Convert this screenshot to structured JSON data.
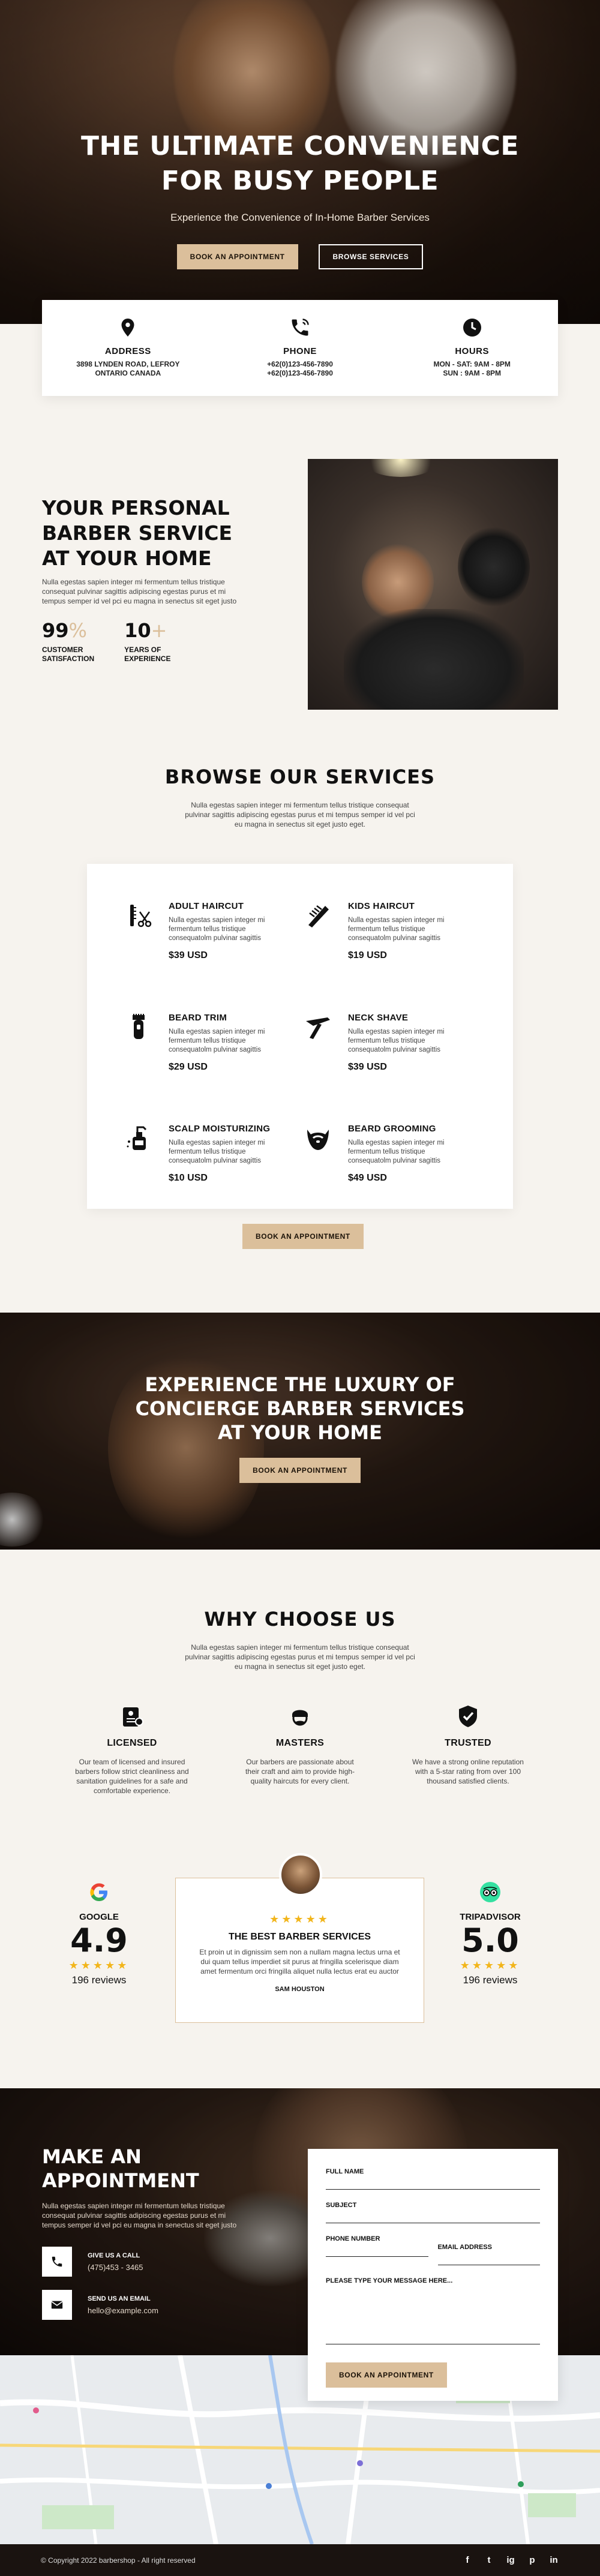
{
  "hero": {
    "title_line1": "THE ULTIMATE CONVENIENCE",
    "title_line2": "FOR BUSY PEOPLE",
    "subtitle": "Experience the Convenience of In-Home Barber Services",
    "btn_appointment": "BOOK AN APPOINTMENT",
    "btn_services": "BROWSE SERVICES"
  },
  "contact": [
    {
      "icon": "location-pin-icon",
      "title": "ADDRESS",
      "line1": "3898 LYNDEN ROAD, LEFROY",
      "line2": "ONTARIO CANADA"
    },
    {
      "icon": "phone-icon",
      "title": "PHONE",
      "line1": "+62(0)123-456-7890",
      "line2": "+62(0)123-456-7890"
    },
    {
      "icon": "clock-icon",
      "title": "HOURS",
      "line1": "MON - SAT: 9AM - 8PM",
      "line2": "SUN : 9AM - 8PM"
    }
  ],
  "about": {
    "title_line1": "YOUR PERSONAL",
    "title_line2": "BARBER SERVICE",
    "title_line3": "AT YOUR HOME",
    "text": "Nulla egestas sapien integer mi fermentum tellus tristique consequat pulvinar sagittis adipiscing egestas purus et mi tempus semper id vel pci eu magna in senectus sit eget justo",
    "stat1_num": "99",
    "stat1_suffix": "%",
    "stat1_label1": "CUSTOMER",
    "stat1_label2": "SATISFACTION",
    "stat2_num": "10",
    "stat2_suffix": "+",
    "stat2_label1": "YEARS OF",
    "stat2_label2": "EXPERIENCE"
  },
  "services": {
    "title": "BROWSE OUR SERVICES",
    "text": "Nulla egestas sapien integer mi fermentum tellus tristique consequat pulvinar sagittis adipiscing egestas purus et mi tempus semper id vel pci eu magna in senectus sit eget justo eget.",
    "items": [
      {
        "icon": "razor-comb-icon",
        "name": "ADULT HAIRCUT",
        "desc": "Nulla egestas sapien integer mi fermentum tellus tristique consequatolm pulvinar sagittis",
        "price": "$39 USD"
      },
      {
        "icon": "comb-icon",
        "name": "KIDS HAIRCUT",
        "desc": "Nulla egestas sapien integer mi fermentum tellus tristique consequatolm pulvinar sagittis",
        "price": "$19 USD"
      },
      {
        "icon": "trimmer-icon",
        "name": "BEARD TRIM",
        "desc": "Nulla egestas sapien integer mi fermentum tellus tristique consequatolm pulvinar sagittis",
        "price": "$29 USD"
      },
      {
        "icon": "straight-razor-icon",
        "name": "NECK SHAVE",
        "desc": "Nulla egestas sapien integer mi fermentum tellus tristique consequatolm pulvinar sagittis",
        "price": "$39 USD"
      },
      {
        "icon": "lotion-bottle-icon",
        "name": "SCALP MOISTURIZING",
        "desc": "Nulla egestas sapien integer mi fermentum tellus tristique consequatolm pulvinar sagittis",
        "price": "$10 USD"
      },
      {
        "icon": "beard-icon",
        "name": "BEARD GROOMING",
        "desc": "Nulla egestas sapien integer mi fermentum tellus tristique consequatolm pulvinar sagittis",
        "price": "$49 USD"
      }
    ],
    "btn": "BOOK AN APPOINTMENT"
  },
  "luxury": {
    "line1": "EXPERIENCE THE LUXURY OF",
    "line2": "CONCIERGE BARBER SERVICES",
    "line3": "AT YOUR HOME",
    "btn": "BOOK AN APPOINTMENT"
  },
  "why": {
    "title": "WHY CHOOSE US",
    "text": "Nulla egestas sapien integer mi fermentum tellus tristique consequat pulvinar sagittis adipiscing egestas purus et mi tempus semper id vel pci eu magna in senectus sit eget justo eget.",
    "items": [
      {
        "icon": "license-card-icon",
        "name": "LICENSED",
        "desc": "Our team of licensed and insured barbers follow strict cleanliness and sanitation guidelines for a safe and comfortable experience."
      },
      {
        "icon": "barber-masters-icon",
        "name": "MASTERS",
        "desc": "Our barbers are passionate about their craft and aim to provide high-quality haircuts for every client."
      },
      {
        "icon": "shield-check-icon",
        "name": "TRUSTED",
        "desc": "We have a strong online reputation with a 5-star rating from over 100 thousand satisfied clients."
      }
    ]
  },
  "reviews": {
    "google_name": "GOOGLE",
    "google_score": "4.9",
    "google_reviews": "196 reviews",
    "tripadvisor_name": "TRIPADVISOR",
    "tripadvisor_score": "5.0",
    "tripadvisor_reviews": "196 reviews",
    "stars": "★★★★★",
    "testimonial_title": "THE BEST BARBER SERVICES",
    "testimonial_text": "Et proin ut in dignissim sem non a nullam magna lectus urna et dui quam tellus imperdiet sit purus at fringilla scelerisque diam amet fermentum orci fringilla aliquet nulla lectus erat eu auctor",
    "testimonial_author": "SAM HOUSTON"
  },
  "appointment": {
    "title_line1": "MAKE AN",
    "title_line2": "APPOINTMENT",
    "text": "Nulla egestas sapien integer mi fermentum tellus tristique consequat pulvinar sagittis adipiscing egestas purus et mi tempus semper id vel pci eu magna in senectus sit eget justo",
    "call_label": "GIVE US A CALL",
    "call_value": "(475)453 - 3465",
    "email_label": "SEND US AN EMAIL",
    "email_value": "hello@example.com",
    "form": {
      "full_name": "FULL NAME",
      "subject": "SUBJECT",
      "phone": "PHONE NUMBER",
      "email": "EMAIL ADDRESS",
      "message": "PLEASE TYPE YOUR MESSAGE HERE...",
      "submit": "BOOK AN APPOINTMENT"
    }
  },
  "footer": {
    "copyright": "© Copyright 2022 barbershop - All right reserved",
    "socials": [
      "f",
      "t",
      "ig",
      "p",
      "in"
    ]
  }
}
